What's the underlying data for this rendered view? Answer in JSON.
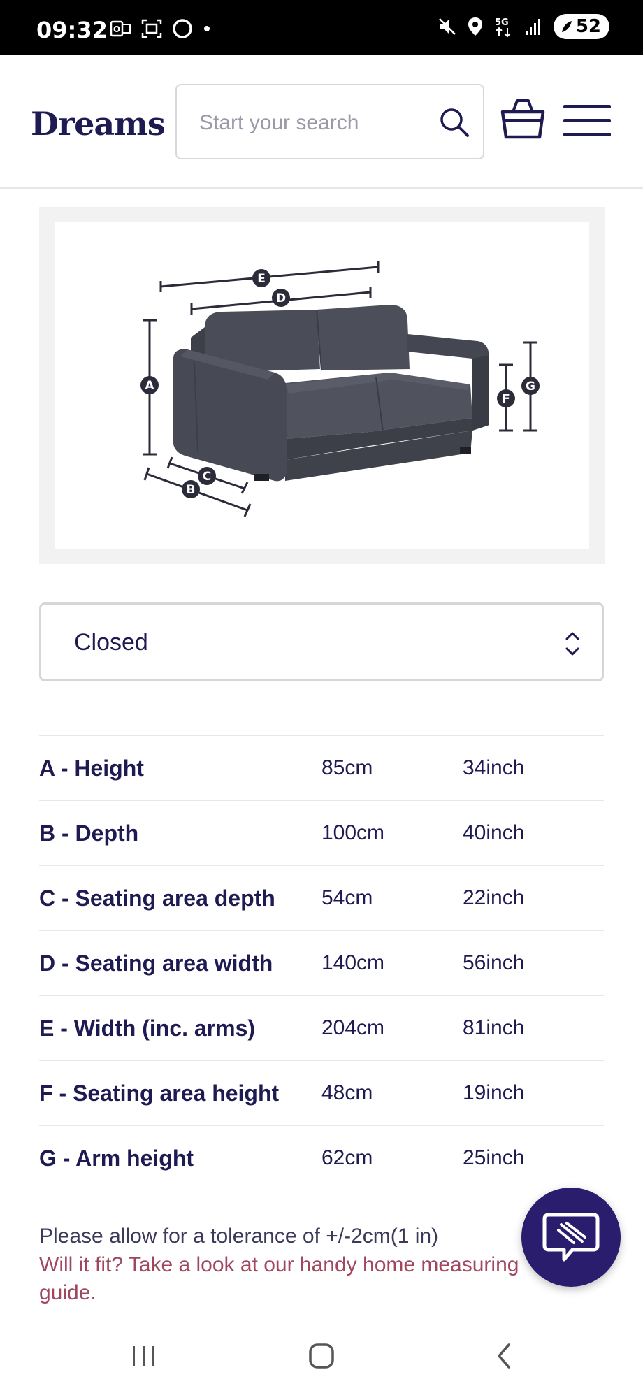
{
  "status_bar": {
    "time": "09:32",
    "battery": "52",
    "icons": [
      "outlook-icon",
      "screenshot-icon",
      "circle-icon",
      "dot-icon",
      "mute-icon",
      "location-icon",
      "5g-icon",
      "signal-icon",
      "battery-icon"
    ]
  },
  "header": {
    "logo": "Dreams",
    "search_placeholder": "Start your search"
  },
  "diagram": {
    "labels": [
      "A",
      "B",
      "C",
      "D",
      "E",
      "F",
      "G"
    ]
  },
  "select": {
    "value": "Closed"
  },
  "dimensions": [
    {
      "label": "A - Height",
      "cm": "85cm",
      "inch": "34inch"
    },
    {
      "label": "B - Depth",
      "cm": "100cm",
      "inch": "40inch"
    },
    {
      "label": "C - Seating area depth",
      "cm": "54cm",
      "inch": "22inch"
    },
    {
      "label": "D - Seating area width",
      "cm": "140cm",
      "inch": "56inch"
    },
    {
      "label": "E - Width (inc. arms)",
      "cm": "204cm",
      "inch": "81inch"
    },
    {
      "label": "F - Seating area height",
      "cm": "48cm",
      "inch": "19inch"
    },
    {
      "label": "G - Arm height",
      "cm": "62cm",
      "inch": "25inch"
    }
  ],
  "footer": {
    "tolerance": "Please allow for a tolerance of +/-2cm(1 in)",
    "fit_link": "Will it fit? Take a look at our handy home measuring guide."
  },
  "colors": {
    "brand": "#1e1a52",
    "link": "#a0475f",
    "chat_button": "#2a1d6e"
  }
}
